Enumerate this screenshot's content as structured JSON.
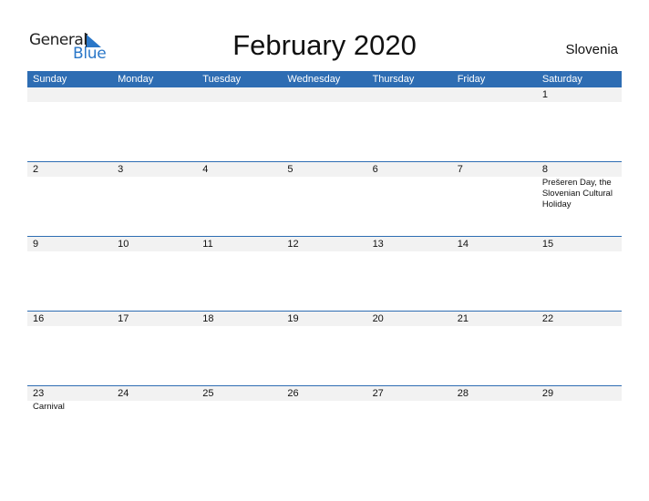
{
  "logo": {
    "general": "General",
    "blue": "Blue",
    "brand_color": "#2a77c8"
  },
  "header": {
    "title": "February 2020",
    "country": "Slovenia"
  },
  "calendar": {
    "header_color": "#2e6db3",
    "days": [
      "Sunday",
      "Monday",
      "Tuesday",
      "Wednesday",
      "Thursday",
      "Friday",
      "Saturday"
    ],
    "weeks": [
      [
        {
          "day": ""
        },
        {
          "day": ""
        },
        {
          "day": ""
        },
        {
          "day": ""
        },
        {
          "day": ""
        },
        {
          "day": ""
        },
        {
          "day": "1"
        }
      ],
      [
        {
          "day": "2"
        },
        {
          "day": "3"
        },
        {
          "day": "4"
        },
        {
          "day": "5"
        },
        {
          "day": "6"
        },
        {
          "day": "7"
        },
        {
          "day": "8",
          "event": "Prešeren Day, the Slovenian Cultural Holiday"
        }
      ],
      [
        {
          "day": "9"
        },
        {
          "day": "10"
        },
        {
          "day": "11"
        },
        {
          "day": "12"
        },
        {
          "day": "13"
        },
        {
          "day": "14"
        },
        {
          "day": "15"
        }
      ],
      [
        {
          "day": "16"
        },
        {
          "day": "17"
        },
        {
          "day": "18"
        },
        {
          "day": "19"
        },
        {
          "day": "20"
        },
        {
          "day": "21"
        },
        {
          "day": "22"
        }
      ],
      [
        {
          "day": "23",
          "event": "Carnival"
        },
        {
          "day": "24"
        },
        {
          "day": "25"
        },
        {
          "day": "26"
        },
        {
          "day": "27"
        },
        {
          "day": "28"
        },
        {
          "day": "29"
        }
      ]
    ]
  }
}
